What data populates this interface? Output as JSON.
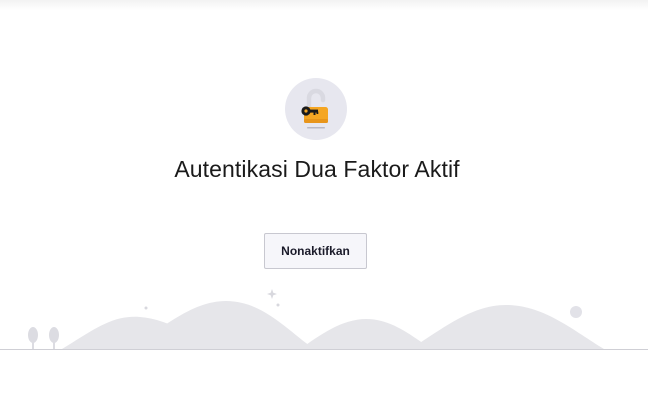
{
  "dialog": {
    "title": "Autentikasi Dua Faktor Aktif",
    "disable_button_label": "Nonaktifkan"
  },
  "icons": {
    "badge": "unlocked-padlock-icon",
    "key": "key-icon"
  },
  "colors": {
    "badge_bg": "#e7e7ef",
    "lock_body": "#f5a623",
    "key": "#1a1a1a",
    "button_bg": "#f6f6fa",
    "illustration": "#e6e6ea"
  }
}
